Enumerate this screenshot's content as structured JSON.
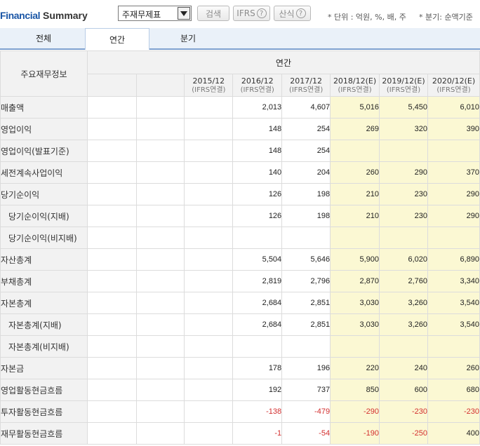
{
  "header": {
    "title_part1": "Financial",
    "title_part2": "Summary",
    "select_value": "주재무제표",
    "search_label": "검색",
    "ifrs_label": "IFRS",
    "formula_label": "산식",
    "help_glyph": "?",
    "unit_note": "* 단위 : 억원, %, 배, 주",
    "period_note": "* 분기: 순액기준"
  },
  "tabs": [
    "전체",
    "연간",
    "분기"
  ],
  "active_tab": "연간",
  "table": {
    "row_header": "주요재무정보",
    "group_header": "연간",
    "columns": [
      {
        "label": "",
        "sub": ""
      },
      {
        "label": "",
        "sub": ""
      },
      {
        "label": "2015/12",
        "sub": "(IFRS연결)"
      },
      {
        "label": "2016/12",
        "sub": "(IFRS연결)"
      },
      {
        "label": "2017/12",
        "sub": "(IFRS연결)"
      },
      {
        "label": "2018/12(E)",
        "sub": "(IFRS연결)"
      },
      {
        "label": "2019/12(E)",
        "sub": "(IFRS연결)"
      },
      {
        "label": "2020/12(E)",
        "sub": "(IFRS연결)"
      }
    ],
    "rows": [
      {
        "name": "매출액",
        "values": [
          "",
          "",
          "",
          "2,013",
          "4,607",
          "5,016",
          "5,450",
          "6,010"
        ]
      },
      {
        "name": "영업이익",
        "values": [
          "",
          "",
          "",
          "148",
          "254",
          "269",
          "320",
          "390"
        ]
      },
      {
        "name": "영업이익(발표기준)",
        "values": [
          "",
          "",
          "",
          "148",
          "254",
          "",
          "",
          ""
        ]
      },
      {
        "name": "세전계속사업이익",
        "values": [
          "",
          "",
          "",
          "140",
          "204",
          "260",
          "290",
          "370"
        ]
      },
      {
        "name": "당기순이익",
        "values": [
          "",
          "",
          "",
          "126",
          "198",
          "210",
          "230",
          "290"
        ]
      },
      {
        "name": "당기순이익(지배)",
        "indent": true,
        "values": [
          "",
          "",
          "",
          "126",
          "198",
          "210",
          "230",
          "290"
        ]
      },
      {
        "name": "당기순이익(비지배)",
        "indent": true,
        "values": [
          "",
          "",
          "",
          "",
          "",
          "",
          "",
          ""
        ]
      },
      {
        "name": "자산총계",
        "values": [
          "",
          "",
          "",
          "5,504",
          "5,646",
          "5,900",
          "6,020",
          "6,890"
        ]
      },
      {
        "name": "부채총계",
        "values": [
          "",
          "",
          "",
          "2,819",
          "2,796",
          "2,870",
          "2,760",
          "3,340"
        ]
      },
      {
        "name": "자본총계",
        "values": [
          "",
          "",
          "",
          "2,684",
          "2,851",
          "3,030",
          "3,260",
          "3,540"
        ]
      },
      {
        "name": "자본총계(지배)",
        "indent": true,
        "values": [
          "",
          "",
          "",
          "2,684",
          "2,851",
          "3,030",
          "3,260",
          "3,540"
        ]
      },
      {
        "name": "자본총계(비지배)",
        "indent": true,
        "values": [
          "",
          "",
          "",
          "",
          "",
          "",
          "",
          ""
        ]
      },
      {
        "name": "자본금",
        "values": [
          "",
          "",
          "",
          "178",
          "196",
          "220",
          "240",
          "260"
        ]
      },
      {
        "name": "영업활동현금흐름",
        "values": [
          "",
          "",
          "",
          "192",
          "737",
          "850",
          "600",
          "680"
        ]
      },
      {
        "name": "투자활동현금흐름",
        "values": [
          "",
          "",
          "",
          "-138",
          "-479",
          "-290",
          "-230",
          "-230"
        ]
      },
      {
        "name": "재무활동현금흐름",
        "values": [
          "",
          "",
          "",
          "-1",
          "-54",
          "-190",
          "-250",
          "400"
        ]
      }
    ]
  },
  "colors": {
    "estimate_bg": "#fbf8d3",
    "negative": "#d32f2f",
    "title_blue": "#1a56a6"
  }
}
